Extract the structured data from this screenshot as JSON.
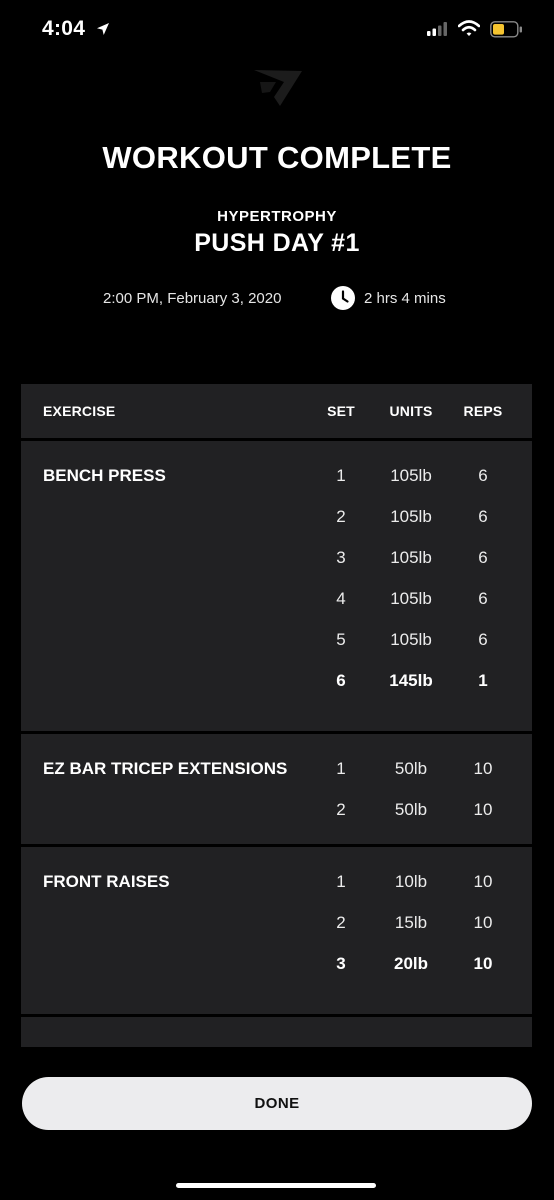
{
  "status_bar": {
    "time": "4:04",
    "icons": [
      "location-arrow-icon",
      "cellular-signal-icon",
      "wifi-icon",
      "battery-icon"
    ],
    "battery_color": "#f5c430"
  },
  "header": {
    "logo_icon": "gymshark-logo-icon",
    "title": "WORKOUT COMPLETE",
    "category": "HYPERTROPHY",
    "workout_name": "PUSH DAY #1",
    "datetime": "2:00 PM, February 3, 2020",
    "duration_icon": "clock-icon",
    "duration": "2 hrs 4 mins"
  },
  "table": {
    "columns": {
      "exercise": "EXERCISE",
      "set": "SET",
      "units": "UNITS",
      "reps": "REPS"
    },
    "exercises": [
      {
        "name": "BENCH PRESS",
        "sets": [
          {
            "set": "1",
            "units": "105lb",
            "reps": "6",
            "best": false
          },
          {
            "set": "2",
            "units": "105lb",
            "reps": "6",
            "best": false
          },
          {
            "set": "3",
            "units": "105lb",
            "reps": "6",
            "best": false
          },
          {
            "set": "4",
            "units": "105lb",
            "reps": "6",
            "best": false
          },
          {
            "set": "5",
            "units": "105lb",
            "reps": "6",
            "best": false
          },
          {
            "set": "6",
            "units": "145lb",
            "reps": "1",
            "best": true
          }
        ]
      },
      {
        "name": "EZ BAR TRICEP EXTENSIONS",
        "sets": [
          {
            "set": "1",
            "units": "50lb",
            "reps": "10",
            "best": false
          },
          {
            "set": "2",
            "units": "50lb",
            "reps": "10",
            "best": false
          }
        ]
      },
      {
        "name": "FRONT RAISES",
        "sets": [
          {
            "set": "1",
            "units": "10lb",
            "reps": "10",
            "best": false
          },
          {
            "set": "2",
            "units": "15lb",
            "reps": "10",
            "best": false
          },
          {
            "set": "3",
            "units": "20lb",
            "reps": "10",
            "best": true
          }
        ]
      }
    ]
  },
  "footer": {
    "done_label": "DONE"
  },
  "colors": {
    "background": "#000000",
    "panel": "#212123",
    "button": "#ececee",
    "text": "#ffffff"
  }
}
